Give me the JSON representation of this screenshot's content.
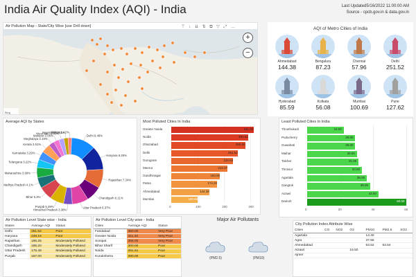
{
  "header": {
    "title": "India Air Quality Index (AQI) - India",
    "last_updated": "Last Updated5/16/2022 11:00:00 AM",
    "source": "Source - cpcb.gov.in & data.gov.in"
  },
  "map": {
    "title": "Air Pollution Map - State/City Wise [use Drill down]",
    "zoom_in": "+",
    "zoom_out": "−",
    "tools": "⊤ ↓ ⇊ ⇅ ⧉ ▽ ⤢ …"
  },
  "metro": {
    "title": "AQI of Metro Cities of India",
    "cities": [
      {
        "name": "Ahmedabad",
        "value": "144.38",
        "color": "#d94a38"
      },
      {
        "name": "Bengaluru",
        "value": "87.23",
        "color": "#e8b34a"
      },
      {
        "name": "Chennai",
        "value": "57.96",
        "color": "#c07a4a"
      },
      {
        "name": "Delhi",
        "value": "251.52",
        "color": "#c94b6b"
      },
      {
        "name": "Hyderabad",
        "value": "85.59",
        "color": "#7a8aa0"
      },
      {
        "name": "Kolkata",
        "value": "56.08",
        "color": "#d9d9d9"
      },
      {
        "name": "Mumbai",
        "value": "100.69",
        "color": "#7a6a8a"
      },
      {
        "name": "Pune",
        "value": "127.62",
        "color": "#a0a0a0"
      }
    ]
  },
  "donut_panel": {
    "title": "Average AQI by States",
    "chart_data": {
      "type": "pie",
      "labels": [
        {
          "text": "Delhi 9.48%",
          "side": "right"
        },
        {
          "text": "Haryana 9.28%",
          "side": "right"
        },
        {
          "text": "Rajasthan 7.34%",
          "side": "right"
        },
        {
          "text": "Chandigarh 6.11%",
          "side": "right"
        },
        {
          "text": "Uttar Pradesh 6.37%",
          "side": "right"
        },
        {
          "text": "Himachal Pradesh 3.38%",
          "side": "right"
        },
        {
          "text": "Punjab 5.49%",
          "side": "left"
        },
        {
          "text": "Bihar 5.3%",
          "side": "left"
        },
        {
          "text": "Madhya Pradesh 4.1%",
          "side": "left"
        },
        {
          "text": "Maharashtra 3.99%",
          "side": "left"
        },
        {
          "text": "Telangana 3.22%",
          "side": "left"
        },
        {
          "text": "Karnataka 3.29%",
          "side": "left"
        },
        {
          "text": "Kerala 3.51%",
          "side": "left"
        },
        {
          "text": "Meghalaya 2.19%",
          "side": "left"
        },
        {
          "text": "Manipur 2.05%",
          "side": "left"
        },
        {
          "text": "West Be... 2.03%",
          "side": "left"
        },
        {
          "text": "Nagaland 1.61%",
          "side": "left"
        },
        {
          "text": "Sikkim 1.42%",
          "side": "left"
        }
      ],
      "values": [
        9.48,
        9.28,
        7.34,
        6.11,
        6.37,
        3.38,
        5.49,
        5.3,
        4.1,
        3.99,
        3.22,
        3.29,
        3.51,
        2.19,
        2.05,
        2.03,
        1.61,
        1.42
      ],
      "colors": [
        "#118dff",
        "#12239e",
        "#e66c37",
        "#6b007b",
        "#e044a7",
        "#744ec2",
        "#d9b300",
        "#d64550",
        "#197278",
        "#1aab40",
        "#15c6f4",
        "#4092ff",
        "#ffa058",
        "#be5dc9",
        "#f472d0",
        "#b5a1ff",
        "#c4a200",
        "#ff8080"
      ]
    }
  },
  "most_panel": {
    "title": "Most Polluted Cities In India",
    "chart_data": {
      "type": "bar",
      "categories": [
        "Greater Noida",
        "Noida",
        "Ghaziabad",
        "Delhi",
        "Gurugram",
        "Meerut",
        "Gandhinagar",
        "Patna",
        "Ahmedabad",
        "Mumbai"
      ],
      "values": [
        311.33,
        291.61,
        280.0,
        251.52,
        234.63,
        213.37,
        184.5,
        174.2,
        144.38,
        100.69
      ],
      "labels": [
        "311.33",
        "291.61",
        "280.00",
        "251.52",
        "234.63",
        "213.37",
        "184.50",
        "174.20",
        "144.38",
        "100.69"
      ],
      "xticks": [
        "0",
        "100",
        "200",
        "300"
      ],
      "xlim": [
        0,
        320
      ]
    }
  },
  "least_panel": {
    "title": "Least Polluted Cities In India",
    "chart_data": {
      "type": "bar",
      "categories": [
        "Thoothukudi",
        "Puducherry",
        "Guwahati",
        "Maihar",
        "Talcher",
        "Thrissur",
        "Agartala",
        "Gangtok",
        "Aizawl",
        "Damoh"
      ],
      "values": [
        22.0,
        29.0,
        29.0,
        30.0,
        31.0,
        33.0,
        36.0,
        38.0,
        43.0,
        60.0
      ],
      "labels": [
        "22.00",
        "29.00",
        "29.00",
        "30.00",
        "31.00",
        "33.00",
        "36.00",
        "38.00",
        "43.00",
        "60.00"
      ],
      "xticks": [
        "0",
        "20",
        "40",
        "60"
      ],
      "xlim": [
        0,
        62
      ]
    }
  },
  "state_table": {
    "title": "Air Pollution Level State wise - India",
    "headers": [
      "States",
      "Average AQI",
      "Status"
    ],
    "rows": [
      [
        "Delhi",
        "251.52",
        "Poor"
      ],
      [
        "Haryana",
        "248.15",
        "Poor"
      ],
      [
        "Rajasthan",
        "196.25",
        "Moderately Polluted"
      ],
      [
        "Chandigarh",
        "185.20",
        "Moderately Polluted"
      ],
      [
        "Uttar Pradesh",
        "175.49",
        "Moderately Polluted"
      ],
      [
        "Punjab",
        "167.00",
        "Moderately Polluted"
      ]
    ]
  },
  "city_table": {
    "title": "Air Pollution Level City wise - India",
    "headers": [
      "Cities",
      "Average AQI",
      "Status"
    ],
    "rows": [
      [
        "Faridabad",
        "350.00",
        "Very Poor"
      ],
      [
        "Greater Noida",
        "311.33",
        "Very Poor"
      ],
      [
        "Sonipat",
        "306.00",
        "Very Poor"
      ],
      [
        "Bihar Sharif",
        "300.00",
        "Poor"
      ],
      [
        "Noida",
        "291.61",
        "Poor"
      ],
      [
        "Kurukshetra",
        "290.00",
        "Poor"
      ]
    ]
  },
  "pollutants": {
    "title": "Major Air Pollutants",
    "items": [
      "(PM2.5)",
      "(PM10)"
    ]
  },
  "attr_table": {
    "title": "City Pollution Index Attribute Wise",
    "headers": [
      "Cities",
      "CO",
      "NO2",
      "O3",
      "PM10",
      "PM2.5",
      "SO2"
    ],
    "rows": [
      [
        "Agartala",
        "",
        "",
        "",
        "14.40",
        "",
        ""
      ],
      [
        "Agra",
        "",
        "",
        "",
        "37.55",
        "",
        ""
      ],
      [
        "Ahmedabad",
        "",
        "",
        "",
        "53.52",
        "53.54",
        ""
      ],
      [
        "Aizawl",
        "",
        "",
        "16.50",
        "",
        "",
        ""
      ],
      [
        "Ajmer",
        "",
        "",
        "",
        "",
        "",
        ""
      ]
    ]
  },
  "status_colors": {
    "Poor": "#f7c948",
    "Very Poor": "#f08a4b",
    "Moderately Polluted": "#f9e79f"
  }
}
